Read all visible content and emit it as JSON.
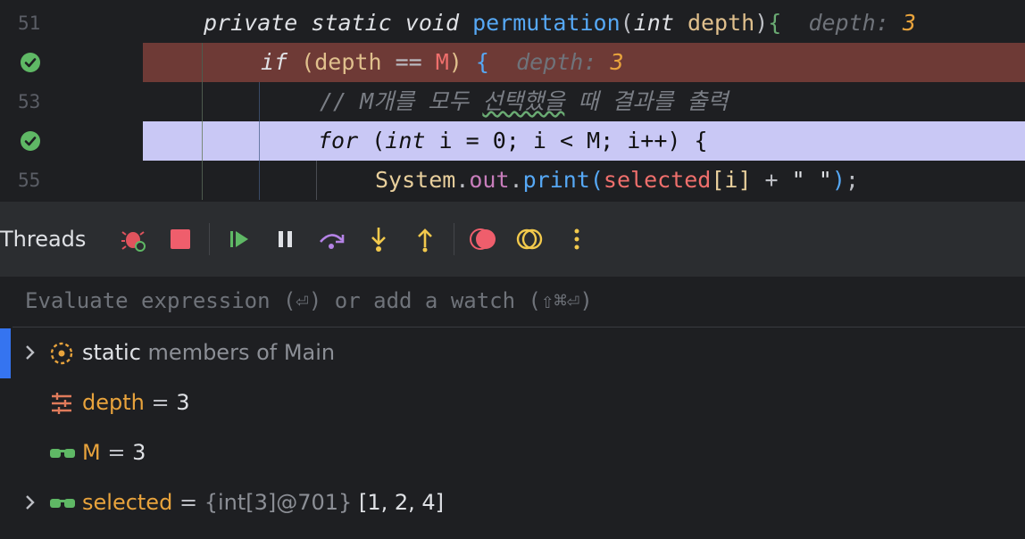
{
  "editor": {
    "lines": [
      {
        "number": "51",
        "marker": "number"
      },
      {
        "number": "52",
        "marker": "check"
      },
      {
        "number": "53",
        "marker": "number"
      },
      {
        "number": "54",
        "marker": "check"
      },
      {
        "number": "55",
        "marker": "number"
      }
    ],
    "line51": {
      "private": "private",
      "static": "static",
      "void": "void",
      "fn": "permutation",
      "lp": "(",
      "int": "int",
      "param": "depth",
      "rp": ")",
      "brace": "{",
      "hint_name": "depth:",
      "hint_val": "3"
    },
    "line52": {
      "if": "if",
      "open": "(",
      "var": "depth",
      "op": "==",
      "field": "M",
      "close": ")",
      "brace": "{",
      "hint_name": "depth:",
      "hint_val": "3"
    },
    "line53": {
      "comment_a": "// M개를 모두 ",
      "comment_b": "선택했을",
      "comment_c": " 때 결과를 출력"
    },
    "line54": {
      "for": "for",
      "open": "(",
      "int": "int",
      "rest1": " i = ",
      "zero": "0",
      "rest2": "; i < ",
      "field": "M",
      "rest3": "; i++",
      "close": ")",
      "brace": "{"
    },
    "line55": {
      "cls": "System",
      "dot1": ".",
      "out": "out",
      "dot2": ".",
      "fn": "print",
      "open": "(",
      "arr": "selected",
      "idx": "[i]",
      "plus": " + ",
      "str": "\" \"",
      "close": ")",
      "semi": ";"
    },
    "colors": {
      "breakpoint_line": "#6e3a36",
      "exec_line": "#c9c8f5",
      "check": "#5fb865"
    }
  },
  "toolbar": {
    "title": "Threads",
    "buttons": [
      "debug-icon",
      "stop-icon",
      "resume-icon",
      "pause-icon",
      "step-over-icon",
      "step-into-icon",
      "step-out-icon",
      "view-breakpoints-icon",
      "mute-breakpoints-icon",
      "more-icon"
    ]
  },
  "watches": {
    "placeholder": "Evaluate expression (⏎) or add a watch (⇧⌘⏎)"
  },
  "variables": [
    {
      "kind": "static",
      "name": "static",
      "desc": "members of Main",
      "expandable": true
    },
    {
      "kind": "param",
      "name": "depth",
      "eq": " = ",
      "value": "3",
      "expandable": false
    },
    {
      "kind": "field",
      "name": "M",
      "eq": " = ",
      "value": "3",
      "expandable": false
    },
    {
      "kind": "field",
      "name": "selected",
      "eq": " = ",
      "type": "{int[3]@701}",
      "value": "[1, 2, 4]",
      "expandable": true
    }
  ]
}
